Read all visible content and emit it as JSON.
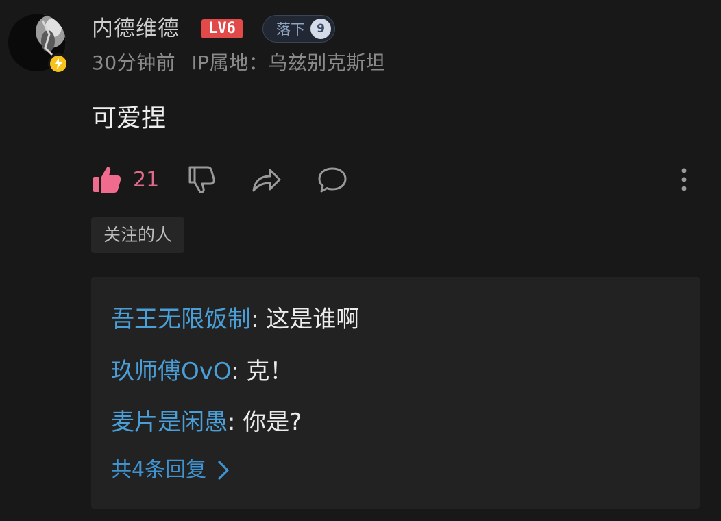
{
  "user": {
    "name": "内德维德",
    "level_label": "LV6",
    "fan_badge": {
      "label": "落下",
      "level": "9"
    },
    "time": "30分钟前",
    "ip_location": "IP属地：乌兹别克斯坦",
    "avatar_icon": "avatar-image",
    "vip_icon": "lightning-icon"
  },
  "comment": {
    "text": "可爱捏"
  },
  "actions": {
    "like_count": "21",
    "like_icon": "thumbs-up-icon",
    "dislike_icon": "thumbs-down-icon",
    "share_icon": "share-arrow-icon",
    "reply_icon": "speech-bubble-icon",
    "more_icon": "vertical-dots-icon"
  },
  "tag": "关注的人",
  "replies": {
    "items": [
      {
        "author": "吾王无限饭制",
        "separator": ":",
        "text": " 这是谁啊"
      },
      {
        "author": "玖师傅OvO",
        "separator": ":",
        "text": " 克！"
      },
      {
        "author": "麦片是闲愚",
        "separator": ":",
        "text": " 你是?"
      }
    ],
    "more_label": "共4条回复"
  },
  "colors": {
    "background": "#181818",
    "like_accent": "#f06c8e",
    "link_blue": "#4a9fd8",
    "level_badge": "#e24a4a",
    "vip_yellow": "#f7c21c"
  }
}
